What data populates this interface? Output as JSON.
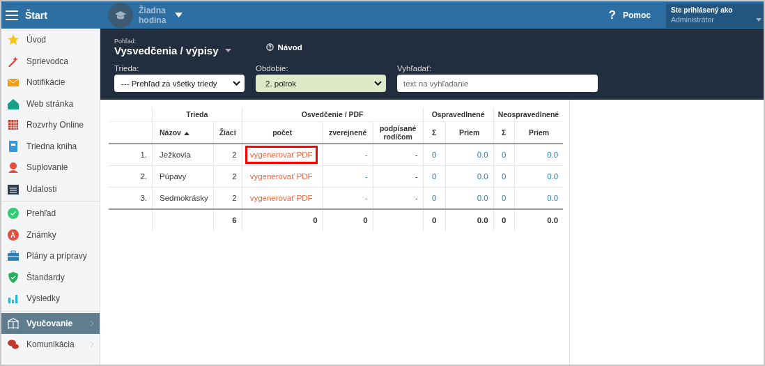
{
  "topbar": {
    "title": "Štart",
    "lesson": "Žiadna hodina",
    "help_icon": "?",
    "help": "Pomoc",
    "user_label": "Ste prihlásený ako",
    "user": "Administrátor"
  },
  "sidebar": {
    "groups": [
      [
        {
          "label": "Úvod",
          "selected": false
        },
        {
          "label": "Sprievodca",
          "selected": false
        },
        {
          "label": "Notifikácie",
          "selected": false
        },
        {
          "label": "Web stránka",
          "selected": false
        },
        {
          "label": "Rozvrhy Online",
          "selected": false
        },
        {
          "label": "Triedna kniha",
          "selected": false
        },
        {
          "label": "Suplovanie",
          "selected": false
        },
        {
          "label": "Udalosti",
          "selected": false
        }
      ],
      [
        {
          "label": "Prehľad",
          "selected": false
        },
        {
          "label": "Známky",
          "selected": false
        },
        {
          "label": "Plány a prípravy",
          "selected": false
        },
        {
          "label": "Štandardy",
          "selected": false
        },
        {
          "label": "Výsledky",
          "selected": false
        }
      ],
      [
        {
          "label": "Vyučovanie",
          "selected": true,
          "expandable": true
        },
        {
          "label": "Komunikácia",
          "selected": false,
          "expandable": true
        }
      ]
    ]
  },
  "header": {
    "view_label": "Pohľad:",
    "view": "Vysvedčenia / výpisy",
    "guide": "Návod",
    "filters": [
      {
        "label": "Trieda:",
        "kind": "select",
        "value": "--- Prehľad za všetky triedy",
        "highlighted": false
      },
      {
        "label": "Obdobie:",
        "kind": "select",
        "value": "2. polrok",
        "highlighted": true
      },
      {
        "label": "Vyhľadať:",
        "kind": "input",
        "placeholder": "text na vyhľadanie"
      }
    ]
  },
  "table": {
    "groups": [
      "Trieda",
      "Osvedčenie / PDF",
      "Ospravedlnené",
      "Neospravedlnené"
    ],
    "columns": [
      "Názov",
      "Žiaci",
      "počet",
      "zverejnené",
      "podpísané rodičom",
      "Σ",
      "Priem",
      "Σ",
      "Priem"
    ],
    "rows": [
      {
        "index": "1.",
        "name": "Ježkovia",
        "students": "2",
        "action": "vygenerovať PDF",
        "highlighted": true,
        "published": "-",
        "signed": "-",
        "exc_sum": "0",
        "exc_avg": "0.0",
        "unexc_sum": "0",
        "unexc_avg": "0.0"
      },
      {
        "index": "2.",
        "name": "Púpavy",
        "students": "2",
        "action": "vygenerovať PDF",
        "highlighted": false,
        "published": "-",
        "signed": "-",
        "exc_sum": "0",
        "exc_avg": "0.0",
        "unexc_sum": "0",
        "unexc_avg": "0.0"
      },
      {
        "index": "3.",
        "name": "Sedmokrásky",
        "students": "2",
        "action": "vygenerovať PDF",
        "highlighted": false,
        "published": "-",
        "signed": "-",
        "exc_sum": "0",
        "exc_avg": "0.0",
        "unexc_sum": "0",
        "unexc_avg": "0.0"
      }
    ],
    "totals": {
      "students": "6",
      "count": "0",
      "published": "0",
      "exc_sum": "0",
      "exc_avg": "0.0",
      "unexc_sum": "0",
      "unexc_avg": "0.0"
    }
  }
}
